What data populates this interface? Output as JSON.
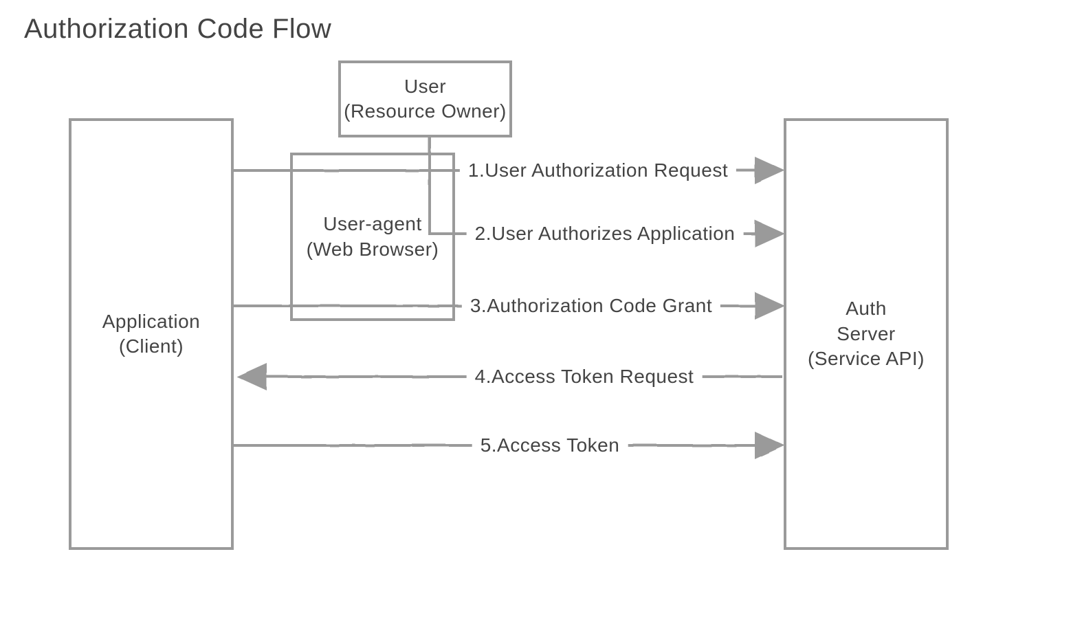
{
  "title": "Authorization Code Flow",
  "actors": {
    "application": {
      "line1": "Application",
      "line2": "(Client)"
    },
    "user": {
      "line1": "User",
      "line2": "(Resource Owner)"
    },
    "user_agent": {
      "line1": "User-agent",
      "line2": "(Web Browser)"
    },
    "auth_server": {
      "line1": "Auth",
      "line2": "Server",
      "line3": "(Service API)"
    }
  },
  "flows": {
    "step1": "1.User Authorization Request",
    "step2": "2.User Authorizes Application",
    "step3": "3.Authorization Code Grant",
    "step4": "4.Access Token Request",
    "step5": "5.Access Token"
  }
}
